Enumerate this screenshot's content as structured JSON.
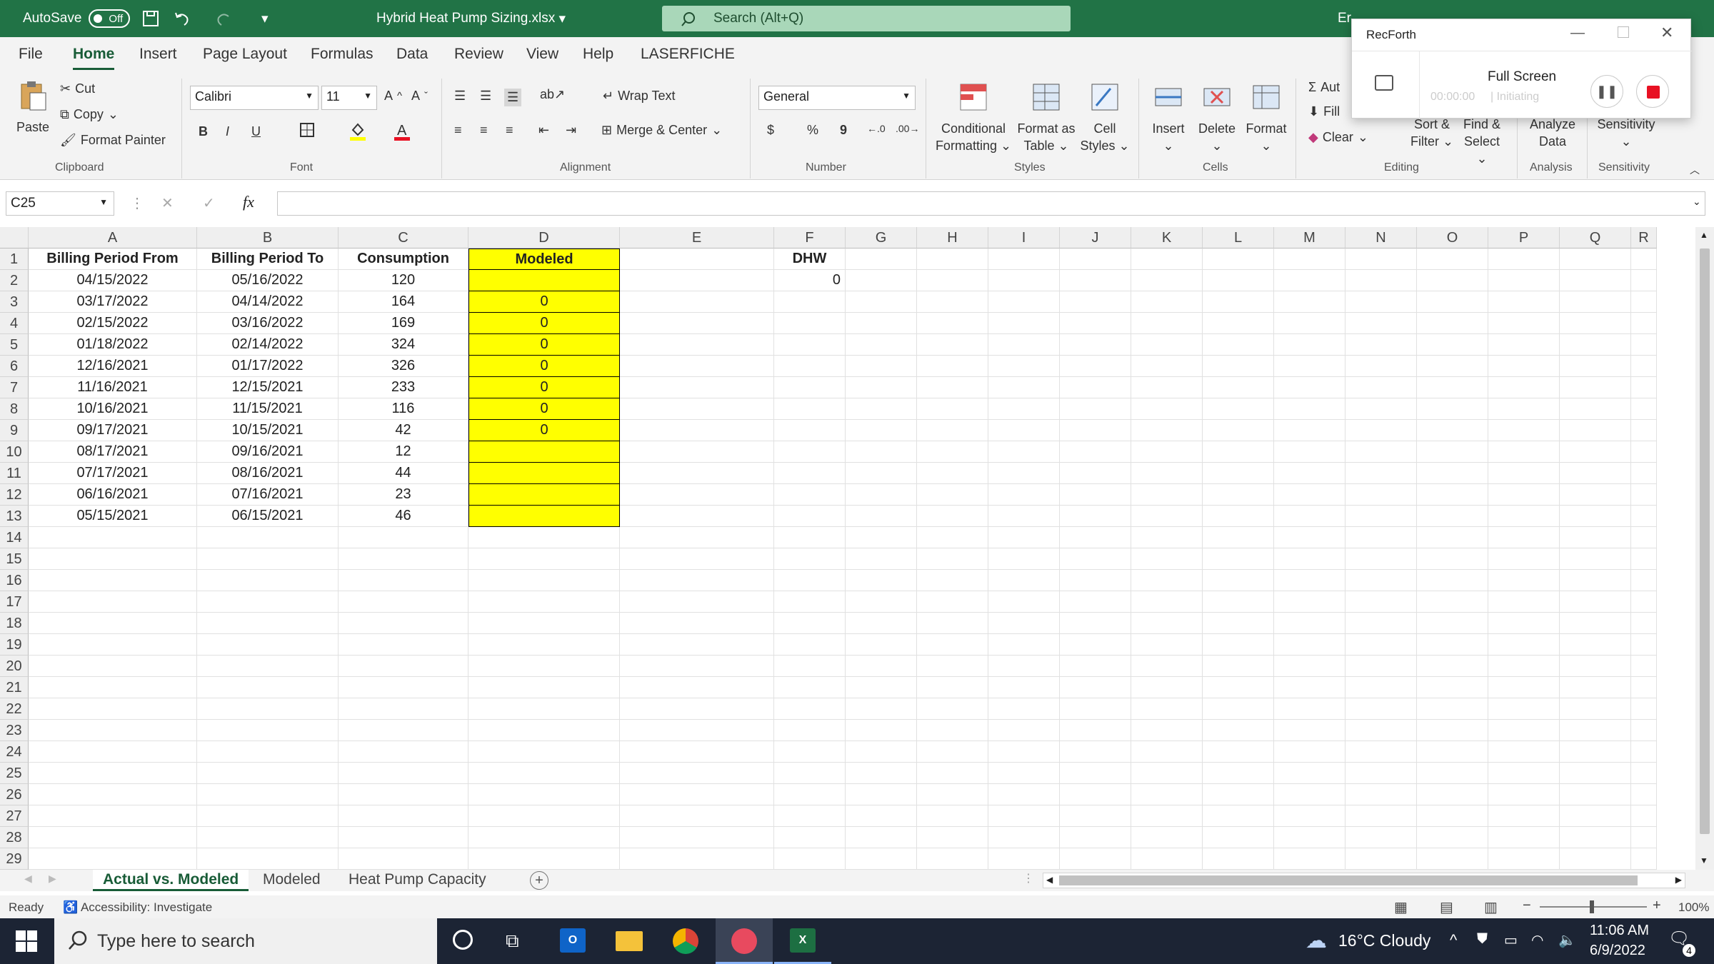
{
  "titlebar": {
    "autosave_label": "AutoSave",
    "autosave_state": "Off",
    "filename": "Hybrid Heat Pump Sizing.xlsx",
    "search_placeholder": "Search (Alt+Q)",
    "user": "Er"
  },
  "menu": [
    "File",
    "Home",
    "Insert",
    "Page Layout",
    "Formulas",
    "Data",
    "Review",
    "View",
    "Help",
    "LASERFICHE"
  ],
  "ribbon": {
    "clipboard": {
      "paste": "Paste",
      "cut": "Cut",
      "copy": "Copy",
      "format_painter": "Format Painter",
      "label": "Clipboard"
    },
    "font": {
      "name": "Calibri",
      "size": "11",
      "bold": "B",
      "italic": "I",
      "underline": "U",
      "label": "Font"
    },
    "alignment": {
      "wrap": "Wrap Text",
      "merge": "Merge & Center",
      "label": "Alignment"
    },
    "number": {
      "format": "General",
      "currency": "$",
      "percent": "%",
      "comma": "9",
      "label": "Number"
    },
    "styles": {
      "conditional": "Conditional",
      "conditional2": "Formatting",
      "format_as": "Format as",
      "format_as2": "Table",
      "cell": "Cell",
      "cell2": "Styles",
      "label": "Styles"
    },
    "cells": {
      "insert": "Insert",
      "delete": "Delete",
      "format": "Format",
      "label": "Cells"
    },
    "editing": {
      "autosum": "Aut",
      "fill": "Fill",
      "clear": "Clear",
      "sort": "Sort &",
      "sort2": "Filter",
      "find": "Find &",
      "find2": "Select",
      "label": "Editing"
    },
    "analysis": {
      "analyze": "Analyze",
      "analyze2": "Data",
      "label": "Analysis"
    },
    "sensitivity": {
      "btn": "Sensitivity",
      "label": "Sensitivity"
    }
  },
  "formula_bar": {
    "cell_ref": "C25",
    "fx": "fx",
    "value": ""
  },
  "grid": {
    "columns": [
      "A",
      "B",
      "C",
      "D",
      "E",
      "F",
      "G",
      "H",
      "I",
      "J",
      "K",
      "L",
      "M",
      "N",
      "O",
      "P",
      "Q",
      "R"
    ],
    "headers": {
      "a": "Billing Period From",
      "b": "Billing Period To",
      "c": "Consumption",
      "d": "Modeled",
      "f": "DHW"
    },
    "f2": "0",
    "rows": [
      {
        "from": "04/15/2022",
        "to": "05/16/2022",
        "consumption": "120",
        "modeled": ""
      },
      {
        "from": "03/17/2022",
        "to": "04/14/2022",
        "consumption": "164",
        "modeled": "0"
      },
      {
        "from": "02/15/2022",
        "to": "03/16/2022",
        "consumption": "169",
        "modeled": "0"
      },
      {
        "from": "01/18/2022",
        "to": "02/14/2022",
        "consumption": "324",
        "modeled": "0"
      },
      {
        "from": "12/16/2021",
        "to": "01/17/2022",
        "consumption": "326",
        "modeled": "0"
      },
      {
        "from": "11/16/2021",
        "to": "12/15/2021",
        "consumption": "233",
        "modeled": "0"
      },
      {
        "from": "10/16/2021",
        "to": "11/15/2021",
        "consumption": "116",
        "modeled": "0"
      },
      {
        "from": "09/17/2021",
        "to": "10/15/2021",
        "consumption": "42",
        "modeled": "0"
      },
      {
        "from": "08/17/2021",
        "to": "09/16/2021",
        "consumption": "12",
        "modeled": ""
      },
      {
        "from": "07/17/2021",
        "to": "08/16/2021",
        "consumption": "44",
        "modeled": ""
      },
      {
        "from": "06/16/2021",
        "to": "07/16/2021",
        "consumption": "23",
        "modeled": ""
      },
      {
        "from": "05/15/2021",
        "to": "06/15/2021",
        "consumption": "46",
        "modeled": ""
      }
    ],
    "highlight_color": "#ffff00"
  },
  "sheets": [
    "Actual vs. Modeled",
    "Modeled",
    "Heat Pump Capacity"
  ],
  "status": {
    "ready": "Ready",
    "accessibility": "Accessibility: Investigate",
    "zoom": "100%"
  },
  "taskbar": {
    "search": "Type here to search",
    "weather": "16°C  Cloudy",
    "time": "11:06 AM",
    "date": "6/9/2022",
    "notifications": "4"
  },
  "recforth": {
    "title": "RecForth",
    "mode": "Full Screen",
    "timer": "00:00:00",
    "status": "Initiating"
  },
  "colors": {
    "excel_green": "#217346",
    "accent": "#185c37",
    "rec_red": "#e81123"
  }
}
